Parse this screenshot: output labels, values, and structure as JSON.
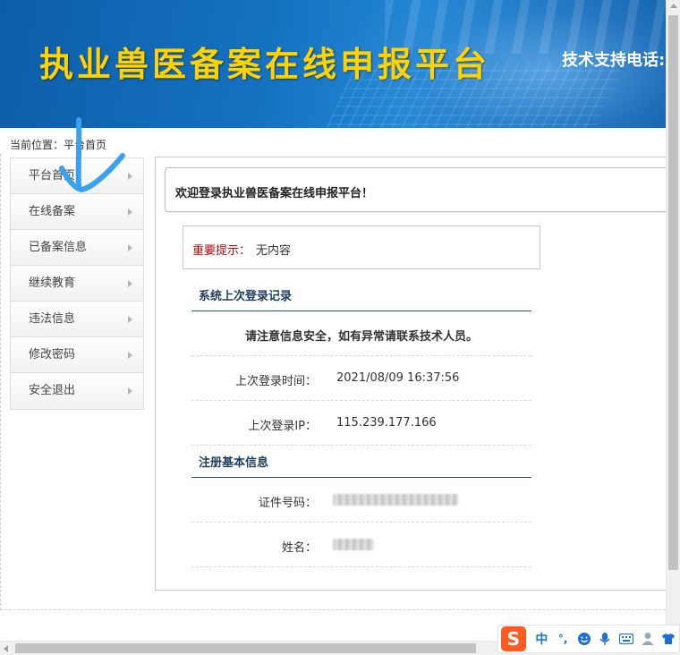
{
  "banner": {
    "title": "执业兽医备案在线申报平台",
    "phone_label": "技术支持电话:"
  },
  "breadcrumb": "当前位置：平台首页",
  "sidebar": {
    "items": [
      {
        "label": "平台首页"
      },
      {
        "label": "在线备案"
      },
      {
        "label": "已备案信息"
      },
      {
        "label": "继续教育"
      },
      {
        "label": "违法信息"
      },
      {
        "label": "修改密码"
      },
      {
        "label": "安全退出"
      }
    ]
  },
  "main": {
    "welcome": "欢迎登录执业兽医备案在线申报平台！",
    "notice": {
      "label": "重要提示：",
      "value": "无内容"
    },
    "login_section": {
      "title": "系统上次登录记录",
      "warning": "请注意信息安全，如有异常请联系技术人员。",
      "last_time_label": "上次登录时间：",
      "last_time_value": "2021/08/09 16:37:56",
      "last_ip_label": "上次登录IP：",
      "last_ip_value": "115.239.177.166"
    },
    "reg_section": {
      "title": "注册基本信息",
      "cert_label": "证件号码：",
      "name_label": "姓名："
    }
  },
  "ime": {
    "logo": "S",
    "lang": "中",
    "punct": "°,"
  },
  "colors": {
    "banner_blue": "#1470bf",
    "title_yellow": "#ffd200",
    "notice_red": "#d00000",
    "section_title": "#1f3d5c",
    "pen_annotation": "#3aa0f0",
    "ime_orange": "#ff5a1f",
    "ime_blue": "#1e6fd9"
  }
}
